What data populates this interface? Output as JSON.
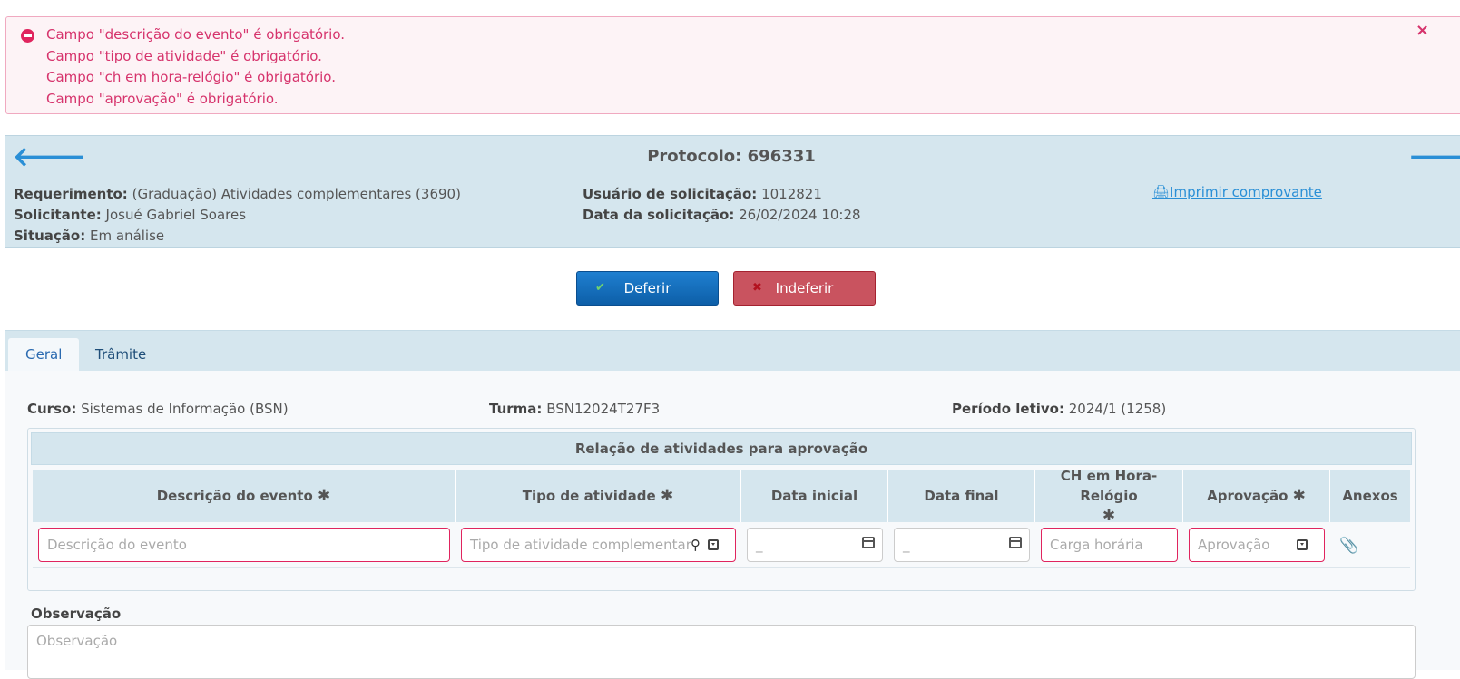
{
  "alert": {
    "messages": [
      "Campo \"descrição do evento\" é obrigatório.",
      "Campo \"tipo de atividade\" é obrigatório.",
      "Campo \"ch em hora-relógio\" é obrigatório.",
      "Campo \"aprovação\" é obrigatório."
    ],
    "close_label": "×"
  },
  "header": {
    "protocol_label": "Protocolo:",
    "protocol_value": "696331",
    "requerimento_label": "Requerimento:",
    "requerimento_value": "(Graduação) Atividades complementares (3690)",
    "solicitante_label": "Solicitante:",
    "solicitante_value": "Josué Gabriel Soares",
    "situacao_label": "Situação:",
    "situacao_value": "Em análise",
    "usuario_label": "Usuário de solicitação:",
    "usuario_value": "1012821",
    "data_label": "Data da solicitação:",
    "data_value": "26/02/2024 10:28",
    "print_label": "Imprimir comprovante"
  },
  "actions": {
    "deferir": "Deferir",
    "indeferir": "Indeferir"
  },
  "tabs": [
    {
      "label": "Geral",
      "active": true
    },
    {
      "label": "Trâmite",
      "active": false
    }
  ],
  "general": {
    "curso_label": "Curso:",
    "curso_value": "Sistemas de Informação (BSN)",
    "turma_label": "Turma:",
    "turma_value": "BSN12024T27F3",
    "periodo_label": "Período letivo:",
    "periodo_value": "2024/1 (1258)"
  },
  "table": {
    "title": "Relação de atividades para aprovação",
    "columns": [
      "Descrição do evento",
      "Tipo de atividade",
      "Data inicial",
      "Data final",
      "CH em Hora-Relógio",
      "Aprovação",
      "Anexos"
    ],
    "row": {
      "descricao_placeholder": "Descrição do evento",
      "tipo_placeholder": "Tipo de atividade complementar",
      "data_inicial_value": "_",
      "data_final_value": "_",
      "carga_placeholder": "Carga horária",
      "aprovacao_placeholder": "Aprovação"
    }
  },
  "observacao": {
    "label": "Observação",
    "placeholder": "Observação"
  },
  "colors": {
    "error": "#d6336c",
    "panel": "#d5e6ee",
    "primary": "#1f7fd0",
    "danger": "#c9535f",
    "link": "#2a8fd6"
  }
}
